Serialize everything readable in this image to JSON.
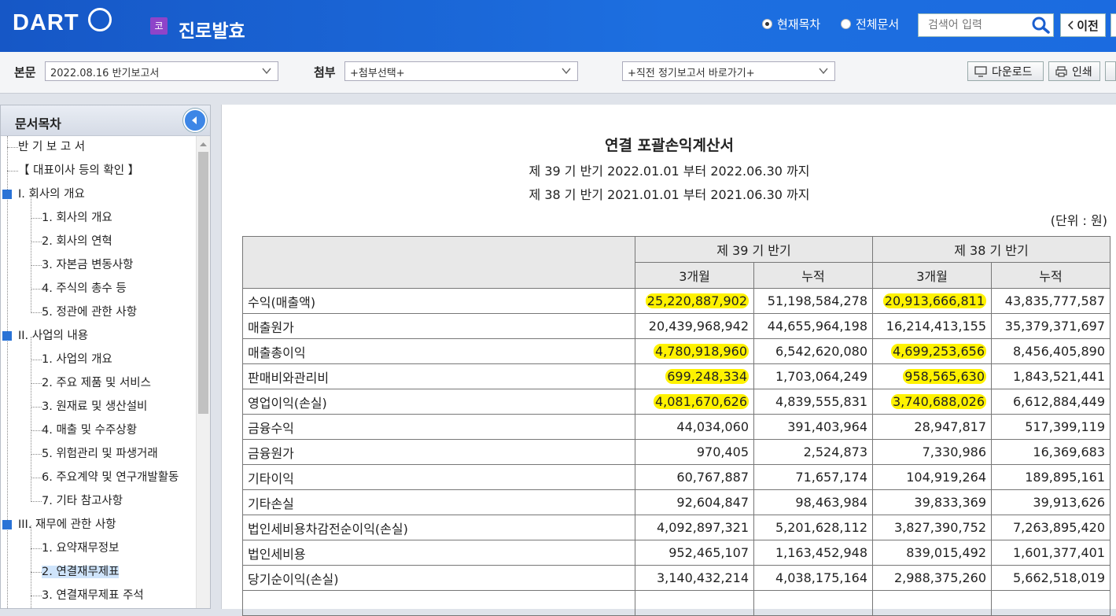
{
  "header": {
    "logo": "DART",
    "corp_badge": "코",
    "corp_name": "진로발효",
    "radio_current": "현재목차",
    "radio_all": "전체문서",
    "search_placeholder": "검색어 입력",
    "prev_label": "이전"
  },
  "toolbar": {
    "body_label": "본문",
    "body_select": "2022.08.16  반기보고서",
    "attach_label": "첨부",
    "attach_select": "+첨부선택+",
    "periodic_select": "+직전 정기보고서 바로가기+",
    "download_label": "다운로드",
    "print_label": "인쇄"
  },
  "sidebar": {
    "title": "문서목차",
    "items": [
      {
        "label": "반 기 보 고 서"
      },
      {
        "label": "【 대표이사 등의 확인 】"
      },
      {
        "label": "I. 회사의 개요"
      },
      {
        "label": "1. 회사의 개요"
      },
      {
        "label": "2. 회사의 연혁"
      },
      {
        "label": "3. 자본금 변동사항"
      },
      {
        "label": "4. 주식의 총수 등"
      },
      {
        "label": "5. 정관에 관한 사항"
      },
      {
        "label": "II. 사업의 내용"
      },
      {
        "label": "1. 사업의 개요"
      },
      {
        "label": "2. 주요 제품 및 서비스"
      },
      {
        "label": "3. 원재료 및 생산설비"
      },
      {
        "label": "4. 매출 및 수주상황"
      },
      {
        "label": "5. 위험관리 및 파생거래"
      },
      {
        "label": "6. 주요계약 및 연구개발활동"
      },
      {
        "label": "7. 기타 참고사항"
      },
      {
        "label": "III. 재무에 관한 사항"
      },
      {
        "label": "1. 요약재무정보"
      },
      {
        "label": "2. 연결재무제표"
      },
      {
        "label": "3. 연결재무제표 주석"
      }
    ]
  },
  "document": {
    "title": "연결 포괄손익계산서",
    "period1": "제 39 기 반기 2022.01.01 부터 2022.06.30 까지",
    "period2": "제 38 기 반기 2021.01.01 부터 2021.06.30 까지",
    "unit": "(단위 : 원)",
    "col_p39": "제 39 기 반기",
    "col_p38": "제 38 기 반기",
    "col_3m": "3개월",
    "col_cum": "누적",
    "rows": [
      {
        "name": "수익(매출액)",
        "v": [
          "25,220,887,902",
          "51,198,584,278",
          "20,913,666,811",
          "43,835,777,587"
        ]
      },
      {
        "name": "매출원가",
        "v": [
          "20,439,968,942",
          "44,655,964,198",
          "16,214,413,155",
          "35,379,371,697"
        ]
      },
      {
        "name": "매출총이익",
        "v": [
          "4,780,918,960",
          "6,542,620,080",
          "4,699,253,656",
          "8,456,405,890"
        ]
      },
      {
        "name": "판매비와관리비",
        "v": [
          "699,248,334",
          "1,703,064,249",
          "958,565,630",
          "1,843,521,441"
        ]
      },
      {
        "name": "영업이익(손실)",
        "v": [
          "4,081,670,626",
          "4,839,555,831",
          "3,740,688,026",
          "6,612,884,449"
        ]
      },
      {
        "name": "금융수익",
        "v": [
          "44,034,060",
          "391,403,964",
          "28,947,817",
          "517,399,119"
        ]
      },
      {
        "name": "금융원가",
        "v": [
          "970,405",
          "2,524,873",
          "7,330,986",
          "16,369,683"
        ]
      },
      {
        "name": "기타이익",
        "v": [
          "60,767,887",
          "71,657,174",
          "104,919,264",
          "189,895,161"
        ]
      },
      {
        "name": "기타손실",
        "v": [
          "92,604,847",
          "98,463,984",
          "39,833,369",
          "39,913,626"
        ]
      },
      {
        "name": "법인세비용차감전순이익(손실)",
        "v": [
          "4,092,897,321",
          "5,201,628,112",
          "3,827,390,752",
          "7,263,895,420"
        ]
      },
      {
        "name": "법인세비용",
        "v": [
          "952,465,107",
          "1,163,452,948",
          "839,015,492",
          "1,601,377,401"
        ]
      },
      {
        "name": "당기순이익(손실)",
        "v": [
          "3,140,432,214",
          "4,038,175,164",
          "2,988,375,260",
          "5,662,518,019"
        ]
      }
    ]
  },
  "colors": {
    "topbar": "#1d6fe0",
    "highlight": "#fff200",
    "selected_item": "#cfe4fb"
  }
}
